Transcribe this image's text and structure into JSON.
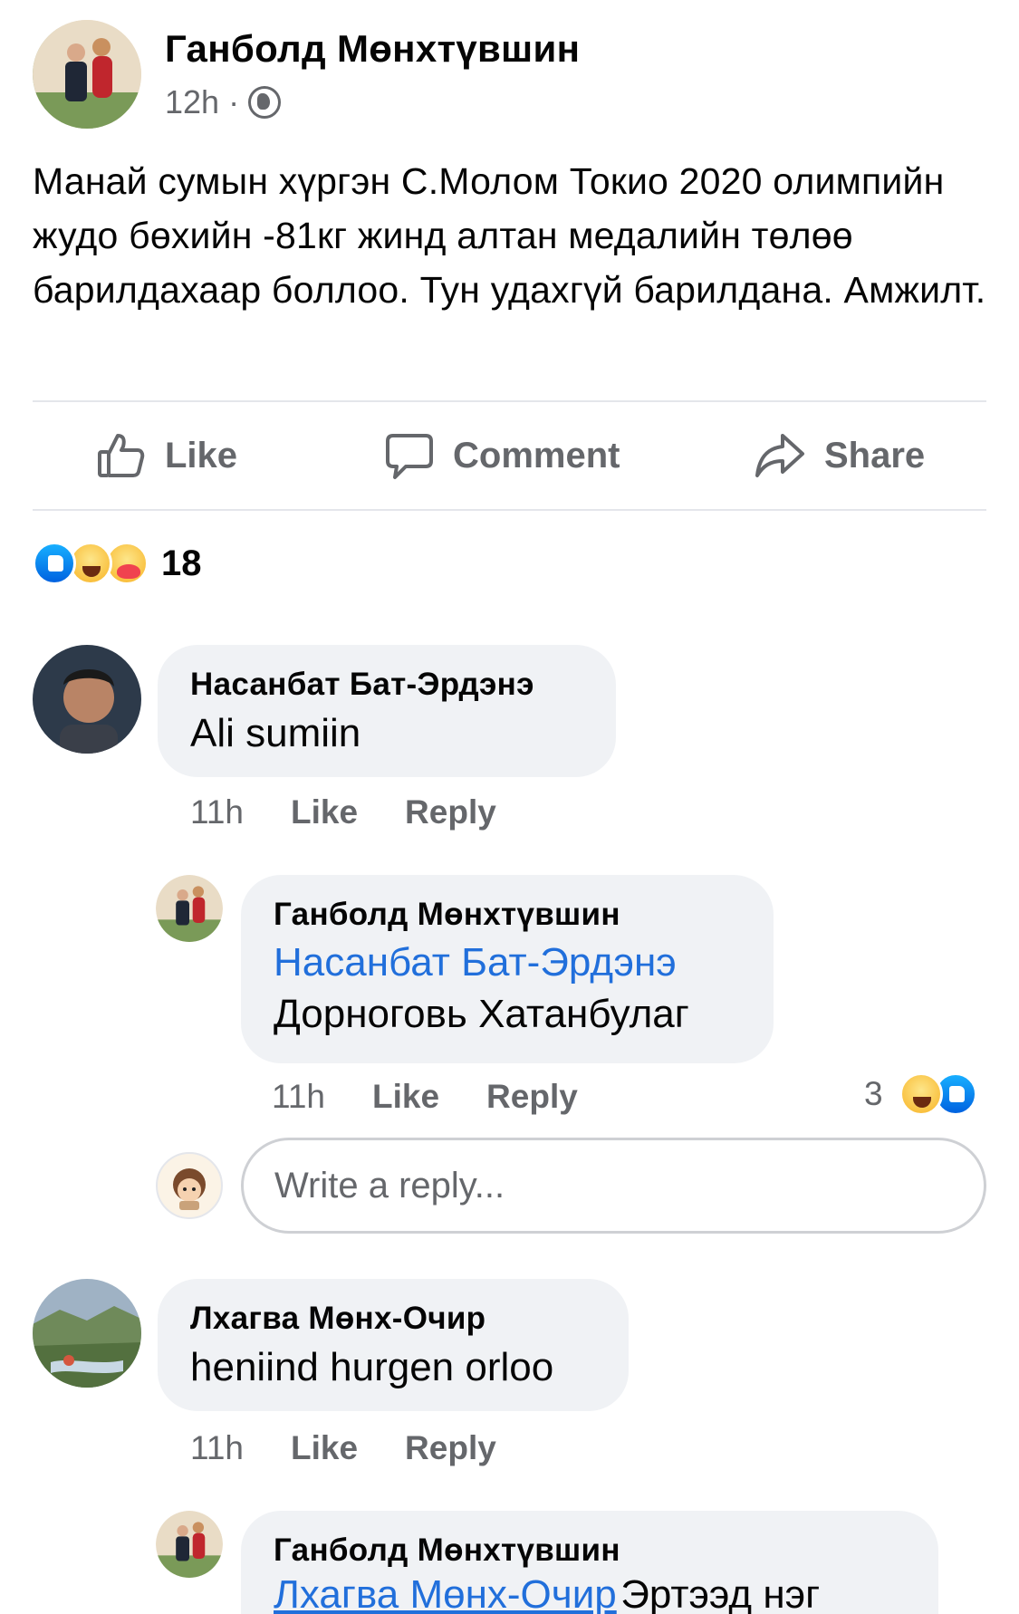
{
  "post": {
    "author": "Ганболд Мөнхтүвшин",
    "time": "12h",
    "separator": "·",
    "privacy_icon": "globe-icon",
    "text": "Манай сумын хүргэн С.Молом Токио 2020 олимпийн жудо бөхийн -81кг жинд алтан медалийн төлөө барилдахаар боллоо. Тун удахгүй барилдана. Амжилт."
  },
  "actions": {
    "like_label": "Like",
    "comment_label": "Comment",
    "share_label": "Share"
  },
  "reactions": {
    "types": [
      "like",
      "haha",
      "care"
    ],
    "count": "18"
  },
  "comments": [
    {
      "author": "Насанбат Бат-Эрдэнэ",
      "text": "Ali sumiin",
      "time": "11h",
      "like_label": "Like",
      "reply_label": "Reply",
      "replies": [
        {
          "author": "Ганболд Мөнхтүвшин",
          "mention": "Насанбат Бат-Эрдэнэ",
          "text": "Дорноговь Хатанбулаг",
          "time": "11h",
          "like_label": "Like",
          "reply_label": "Reply",
          "reaction_count": "3",
          "reaction_types": [
            "haha",
            "like"
          ]
        }
      ]
    },
    {
      "author": "Лхагва Мөнх-Очир",
      "text": "heniind hurgen orloo",
      "time": "11h",
      "like_label": "Like",
      "reply_label": "Reply",
      "replies": [
        {
          "author": "Ганболд Мөнхтүвшин",
          "mention": "Лхагва Мөнх-Очир",
          "text": "Эртээд нэг"
        }
      ]
    }
  ],
  "reply_box": {
    "placeholder": "Write a reply..."
  },
  "colors": {
    "link": "#216fdb",
    "secondary_text": "#65676b",
    "bubble_bg": "#f0f2f5",
    "like_blue": "#1877f2",
    "haha_yellow": "#f8b324"
  }
}
